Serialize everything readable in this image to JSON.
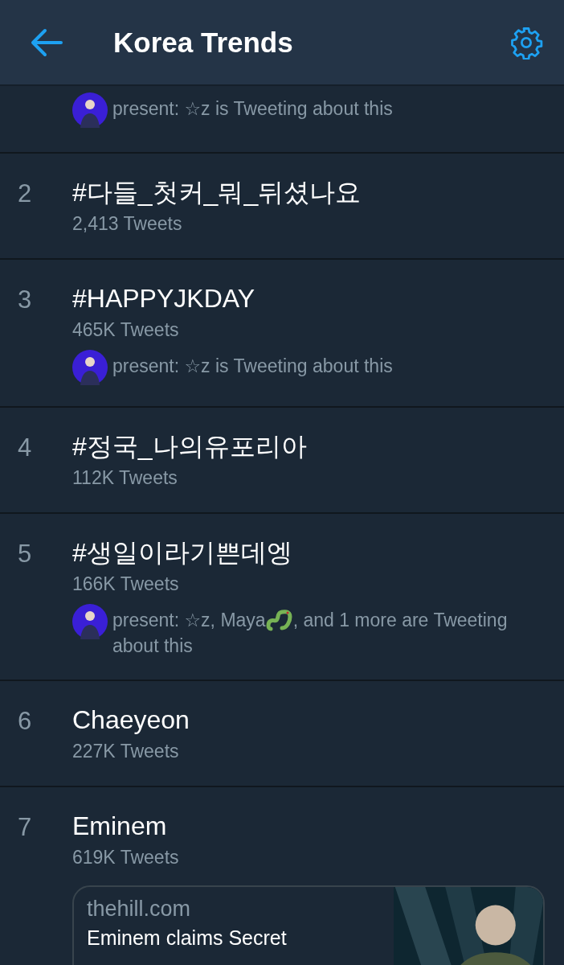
{
  "header": {
    "title": "Korea Trends"
  },
  "trends": [
    {
      "presence": {
        "text": "present: ☆z is Tweeting about this"
      }
    },
    {
      "rank": "2",
      "name": "#다들_첫커_뭐_뒤셨나요",
      "count": "2,413 Tweets"
    },
    {
      "rank": "3",
      "name": "#HAPPYJKDAY",
      "count": "465K Tweets",
      "presence": {
        "text": "present: ☆z is Tweeting about this"
      }
    },
    {
      "rank": "4",
      "name": "#정국_나의유포리아",
      "count": "112K Tweets"
    },
    {
      "rank": "5",
      "name": "#생일이라기쁜데엥",
      "count": "166K Tweets",
      "presence": {
        "text": "present: ☆z, Maya",
        "after_icon": ", and 1 more are Tweeting",
        "next_line": "about this"
      }
    },
    {
      "rank": "6",
      "name": "Chaeyeon",
      "count": "227K Tweets"
    },
    {
      "rank": "7",
      "name": "Eminem",
      "count": "619K Tweets",
      "card": {
        "site": "thehill.com",
        "title": "Eminem claims Secret"
      }
    }
  ]
}
